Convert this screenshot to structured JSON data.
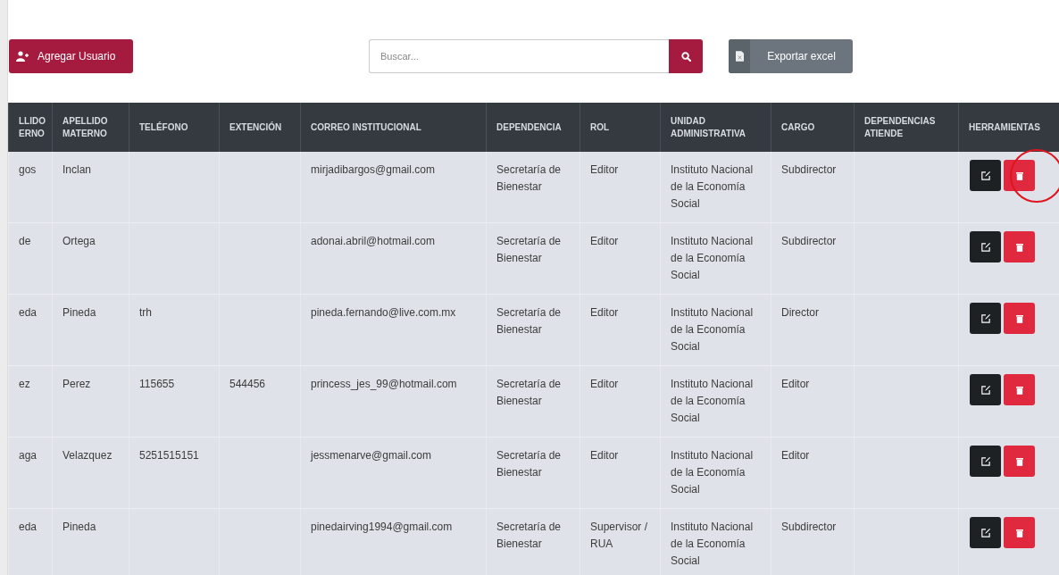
{
  "toolbar": {
    "add_button": "Agregar Usuario",
    "search": {
      "placeholder": "Buscar..."
    },
    "export_button": "Exportar excel"
  },
  "table": {
    "columns": [
      {
        "label": "LLIDO ERNO",
        "kind": "text"
      },
      {
        "label": "APELLIDO MATERNO",
        "kind": "text"
      },
      {
        "label": "TELÉFONO",
        "kind": "text"
      },
      {
        "label": "EXTENCIÓN",
        "kind": "text"
      },
      {
        "label": "CORREO INSTITUCIONAL",
        "kind": "text"
      },
      {
        "label": "DEPENDENCIA",
        "kind": "text"
      },
      {
        "label": "ROL",
        "kind": "text"
      },
      {
        "label": "UNIDAD ADMINISTRATIVA",
        "kind": "text"
      },
      {
        "label": "CARGO",
        "kind": "text"
      },
      {
        "label": "DEPENDENCIAS ATIENDE",
        "kind": "text"
      },
      {
        "label": "HERRAMIENTAS",
        "kind": "tools"
      }
    ],
    "rows": [
      {
        "cells": [
          "gos",
          "Inclan",
          null,
          null,
          "mirjadibargos@gmail.com",
          "Secretaría de Bienestar",
          "Editor",
          "Instituto Nacional de la Economía Social",
          "Subdirector",
          null
        ],
        "delete_circled": true
      },
      {
        "cells": [
          "de",
          "Ortega",
          null,
          null,
          "adonai.abril@hotmail.com",
          "Secretaría de Bienestar",
          "Editor",
          "Instituto Nacional de la Economía Social",
          "Subdirector",
          null
        ],
        "delete_circled": false
      },
      {
        "cells": [
          "eda",
          "Pineda",
          "trh",
          null,
          "pineda.fernando@live.com.mx",
          "Secretaría de Bienestar",
          "Editor",
          "Instituto Nacional de la Economía Social",
          "Director",
          null
        ],
        "delete_circled": false
      },
      {
        "cells": [
          "ez",
          "Perez",
          "115655",
          "544456",
          "princess_jes_99@hotmail.com",
          "Secretaría de Bienestar",
          "Editor",
          "Instituto Nacional de la Economía Social",
          "Editor",
          null
        ],
        "delete_circled": false
      },
      {
        "cells": [
          "aga",
          "Velazquez",
          "5251515151",
          null,
          "jessmenarve@gmail.com",
          "Secretaría de Bienestar",
          "Editor",
          "Instituto Nacional de la Economía Social",
          "Editor",
          null
        ],
        "delete_circled": false
      },
      {
        "cells": [
          "eda",
          "Pineda",
          null,
          null,
          "pinedairving1994@gmail.com",
          "Secretaría de Bienestar",
          "Supervisor / RUA",
          "Instituto Nacional de la Economía Social",
          "Subdirector",
          null
        ],
        "delete_circled": false
      }
    ]
  }
}
